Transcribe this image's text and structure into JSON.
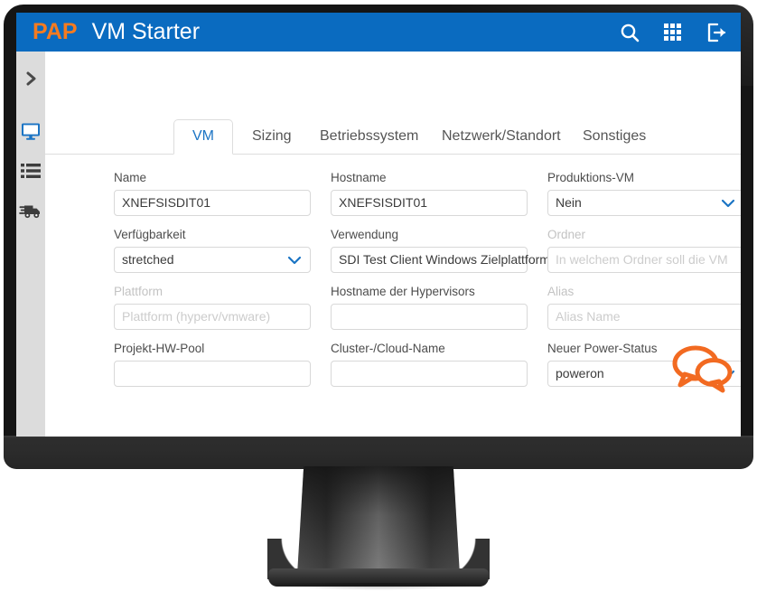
{
  "header": {
    "brand": "PAP",
    "title": "VM Starter",
    "icons": [
      {
        "name": "search-icon",
        "label": "Suche"
      },
      {
        "name": "apps-grid-icon",
        "label": "Apps"
      },
      {
        "name": "logout-icon",
        "label": "Abmelden"
      }
    ],
    "background_color": "#0a6bc0",
    "brand_color": "#f57b20"
  },
  "sidebar": {
    "background_color": "#dcdcdc",
    "items": [
      {
        "name": "expand-sidebar",
        "icon": "chevron-right-icon",
        "active": false
      },
      {
        "name": "monitor",
        "icon": "monitor-icon",
        "active": true
      },
      {
        "name": "list",
        "icon": "list-icon",
        "active": false
      },
      {
        "name": "delivery",
        "icon": "truck-icon",
        "active": false
      }
    ],
    "active_color": "#1b74c4",
    "icon_color": "#4a4a4a"
  },
  "tabs": {
    "active_color": "#1b74c4",
    "items": [
      {
        "label": "VM",
        "active": true
      },
      {
        "label": "Sizing",
        "active": false
      },
      {
        "label": "Betriebssystem",
        "active": false
      },
      {
        "label": "Netzwerk/Standort",
        "active": false
      },
      {
        "label": "Sonstiges",
        "active": false
      }
    ]
  },
  "form": {
    "rows": [
      {
        "fields": [
          {
            "label": "Name",
            "value": "XNEFSISDIT01",
            "placeholder": "",
            "type": "text",
            "disabled": false
          },
          {
            "label": "Hostname",
            "value": "XNEFSISDIT01",
            "placeholder": "",
            "type": "text",
            "disabled": false
          },
          {
            "label": "Produktions-VM",
            "value": "Nein",
            "placeholder": "",
            "type": "select",
            "disabled": false
          }
        ]
      },
      {
        "fields": [
          {
            "label": "Verfügbarkeit",
            "value": "stretched",
            "placeholder": "",
            "type": "select",
            "disabled": false
          },
          {
            "label": "Verwendung",
            "value": "SDI Test Client Windows Zielplattform",
            "placeholder": "",
            "type": "text",
            "disabled": false
          },
          {
            "label": "Ordner",
            "value": "",
            "placeholder": "In welchem Ordner soll die VM",
            "type": "text",
            "disabled": true
          }
        ]
      },
      {
        "fields": [
          {
            "label": "Plattform",
            "value": "",
            "placeholder": "Plattform (hyperv/vmware)",
            "type": "text",
            "disabled": true
          },
          {
            "label": "Hostname der Hypervisors",
            "value": "",
            "placeholder": "",
            "type": "text",
            "disabled": false
          },
          {
            "label": "Alias",
            "value": "",
            "placeholder": "Alias Name",
            "type": "text",
            "disabled": true
          }
        ]
      },
      {
        "fields": [
          {
            "label": "Projekt-HW-Pool",
            "value": "",
            "placeholder": "",
            "type": "text",
            "disabled": false
          },
          {
            "label": "Cluster-/Cloud-Name",
            "value": "",
            "placeholder": "",
            "type": "text",
            "disabled": false
          },
          {
            "label": "Neuer Power-Status",
            "value": "poweron",
            "placeholder": "",
            "type": "select",
            "disabled": false
          }
        ]
      }
    ]
  },
  "chat_widget": {
    "name": "chat-bubbles-icon",
    "color": "#f26a21"
  }
}
